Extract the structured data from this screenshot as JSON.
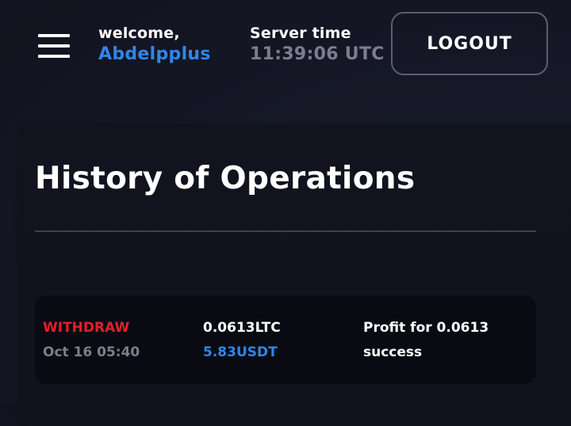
{
  "header": {
    "menu_icon": "hamburger-menu-icon",
    "welcome_label": "welcome,",
    "username": "Abdelpplus",
    "server_time_label": "Server time",
    "server_time": "11:39:06 UTC",
    "logout_label": "LOGOUT"
  },
  "history": {
    "title": "History of Operations",
    "operations": [
      {
        "type": "WITHDRAW",
        "date": "Oct 16 05:40",
        "amount": "0.0613LTC",
        "usd_value": "5.83USDT",
        "description": "Profit for 0.0613",
        "status": "success"
      }
    ]
  },
  "colors": {
    "accent_blue": "#2f86e8",
    "withdraw_red": "#e21f2a",
    "muted_gray": "#7b7f8c"
  }
}
